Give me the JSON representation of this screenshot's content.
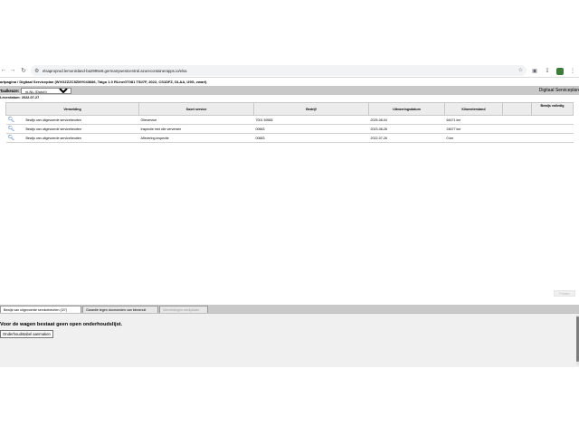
{
  "browser": {
    "url": "elsaproprod.lemonisland-ba2995e8.germanywestcentral.azurecontainerapps.io/elsa"
  },
  "app": {
    "breadcrumb": "artpagina / Digitaal Serviceplan (WVGZZZC5ZMY043686, Taigo 1.0 RLineGT081 TSI/7F, 2022, CS1DFZ, DLAA, U9G, zwart)",
    "title": "Digitaal Serviceplan",
    "language_label": "Taalkeuze:",
    "language_value": "nl-NL (Dutch)",
    "date_line": "Leverdatum: 2022-07-27"
  },
  "table": {
    "headers": [
      "Vermelding",
      "Soort service",
      "Bedrijf",
      "Uitvoeringsdatum",
      "Kilometerstand",
      "",
      "Bewijs volledig"
    ],
    "rows": [
      {
        "vermelding": "Bewijs van uitgevoerde servicebeurten",
        "soort": "Olieservice",
        "bedrijf": "7001 59565",
        "datum": "2025-08-04",
        "km": "64471 km"
      },
      {
        "vermelding": "Bewijs van uitgevoerde servicebeurten",
        "soort": "Inspectie met olie verversen",
        "bedrijf": "00663",
        "datum": "2023-08-28",
        "km": "24677 km"
      },
      {
        "vermelding": "Bewijs van uitgevoerde servicebeurten",
        "soort": "Aflevering inspectie",
        "bedrijf": "00663",
        "datum": "2022-07-26",
        "km": "0 km"
      }
    ]
  },
  "actions": {
    "disabled_button": "Printen"
  },
  "tabs": [
    {
      "label": "Bewijs van uitgevoerde servicebeurten (3/7)"
    },
    {
      "label": "Garantie tegen doorroesten van binnenuit"
    },
    {
      "label": "Vermeldingen werkplaats"
    }
  ],
  "panel": {
    "message": "Voor de wagen bestaat geen open onderhoudslijst.",
    "button": "Onderhoudstabel aanmaken"
  },
  "icons": {
    "row_icon": "magnifier-icon",
    "accent": "#2a5fa8"
  }
}
